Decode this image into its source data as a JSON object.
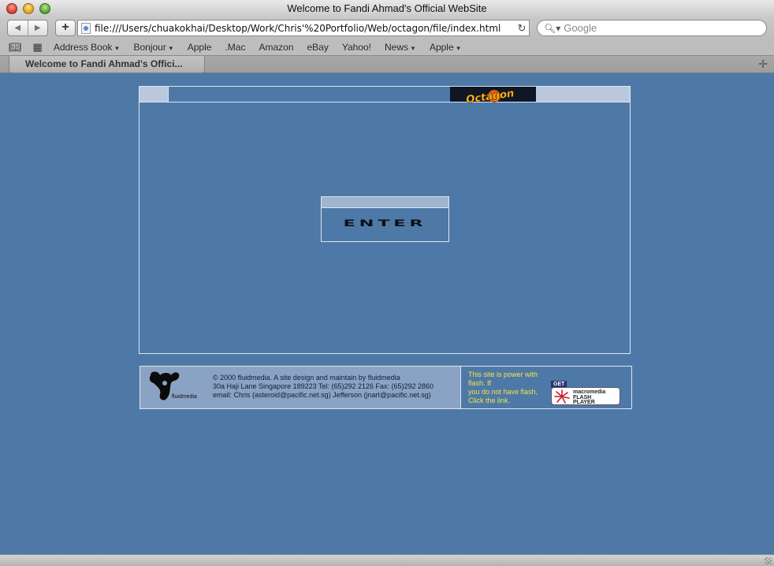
{
  "window": {
    "title": "Welcome to Fandi Ahmad's Official WebSite"
  },
  "toolbar": {
    "back_icon": "back-arrow-icon",
    "forward_icon": "forward-arrow-icon",
    "add_label": "+",
    "url": "file:///Users/chuakokhai/Desktop/Work/Chris'%20Portfolio/Web/octagon/file/index.html",
    "reload_icon": "reload-icon",
    "search_placeholder": "Google"
  },
  "bookmarks": {
    "items": [
      {
        "label": "Address Book",
        "has_menu": true
      },
      {
        "label": "Bonjour",
        "has_menu": true
      },
      {
        "label": "Apple",
        "has_menu": false
      },
      {
        "label": ".Mac",
        "has_menu": false
      },
      {
        "label": "Amazon",
        "has_menu": false
      },
      {
        "label": "eBay",
        "has_menu": false
      },
      {
        "label": "Yahoo!",
        "has_menu": false
      },
      {
        "label": "News",
        "has_menu": true
      },
      {
        "label": "Apple",
        "has_menu": true
      }
    ]
  },
  "tabs": [
    {
      "label": "Welcome to Fandi Ahmad's Offici..."
    }
  ],
  "page": {
    "logo_text": "Octagon",
    "enter_label": "ENTER",
    "footer": {
      "brand": "fluidmedia",
      "lines": [
        "© 2000 fluidmedia. A site design and maintain by fluidmedia",
        "30a Haji Lane Singapore 189223 Tel: (65)292 2126 Fax: (65)292 2860",
        "email: Chris (asteroid@pacific.net.sg) Jefferson (jnart@pacific.net.sg)"
      ],
      "flash_notice": [
        "This site is power with flash. If",
        "you do not have flash,",
        "Click the link."
      ],
      "flash_badge": {
        "get": "GET",
        "line1": "macromedia",
        "line2": "FLASH",
        "line3": "PLAYER"
      }
    }
  },
  "colors": {
    "page_bg": "#4e79a7",
    "frame_border": "#dde6f2",
    "panel": "#b9c8dc",
    "notice_text": "#f3e347"
  }
}
